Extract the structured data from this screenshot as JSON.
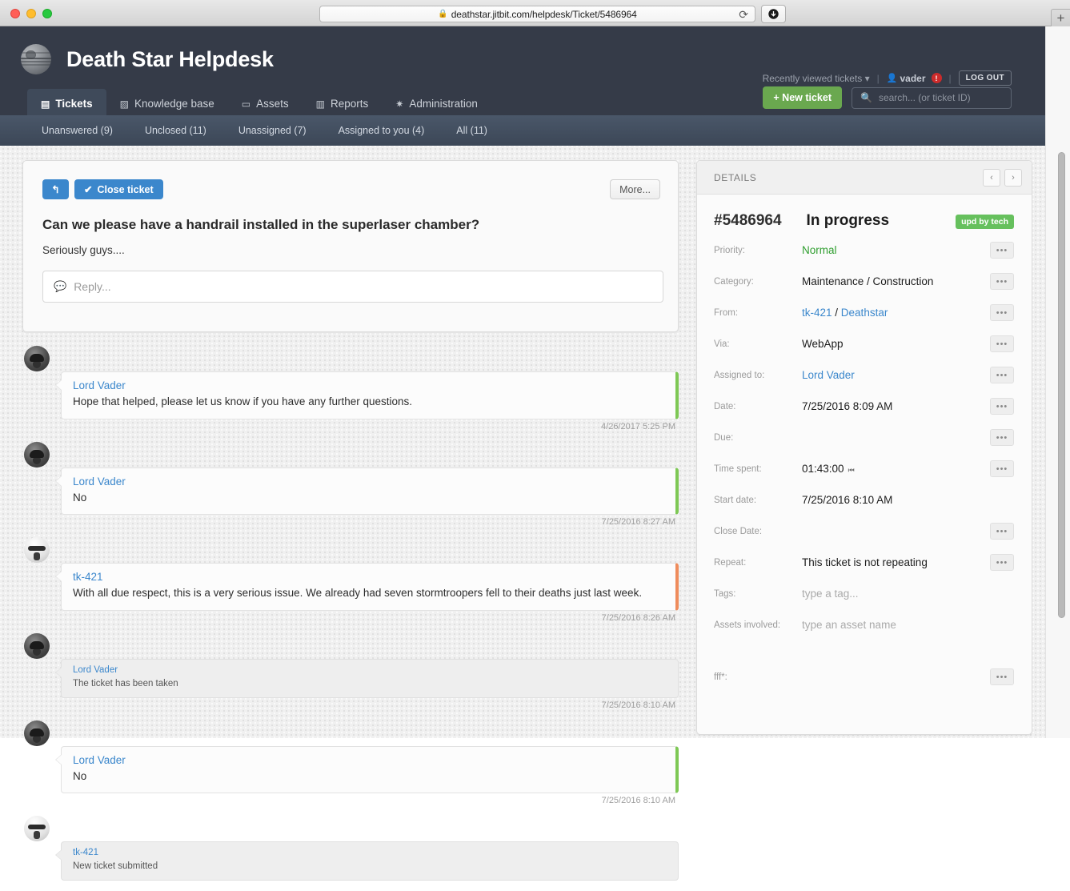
{
  "browser": {
    "url": "deathstar.jitbit.com/helpdesk/Ticket/5486964",
    "lock_icon": "lock-icon",
    "reload_icon": "reload-icon",
    "download_icon": "download-icon",
    "new_tab_label": "+"
  },
  "header": {
    "site_title": "Death Star Helpdesk",
    "logo_icon": "death-star-logo-icon",
    "recently_viewed": "Recently viewed tickets",
    "caret": "▾",
    "user_icon": "user-icon",
    "username": "vader",
    "alert_count": "!",
    "logout_label": "LOG OUT",
    "separator": "|"
  },
  "nav": {
    "tabs": [
      {
        "label": "Tickets",
        "icon": "ticket-icon",
        "glyph": "▤",
        "active": true
      },
      {
        "label": "Knowledge base",
        "icon": "book-icon",
        "glyph": "▨",
        "active": false
      },
      {
        "label": "Assets",
        "icon": "monitor-icon",
        "glyph": "▭",
        "active": false
      },
      {
        "label": "Reports",
        "icon": "chart-icon",
        "glyph": "▥",
        "active": false
      },
      {
        "label": "Administration",
        "icon": "gear-icon",
        "glyph": "✷",
        "active": false
      }
    ],
    "new_ticket_label": "+ New ticket",
    "search_placeholder": "search... (or ticket ID)",
    "search_value": "",
    "search_icon": "search-icon"
  },
  "subnav": {
    "items": [
      {
        "label": "Unanswered (9)"
      },
      {
        "label": "Unclosed (11)"
      },
      {
        "label": "Unassigned (7)"
      },
      {
        "label": "Assigned to you (4)"
      },
      {
        "label": "All (11)"
      }
    ]
  },
  "ticket": {
    "reply_arrow_icon": "reply-arrow-icon",
    "reply_arrow_glyph": "↰",
    "close_ticket_label": "Close ticket",
    "check_glyph": "✔",
    "more_label": "More...",
    "subject": "Can we please have a handrail installed in the superlaser chamber?",
    "body": "Seriously guys....",
    "reply_placeholder": "Reply...",
    "reply_icon": "comment-bubble-icon"
  },
  "comments": [
    {
      "author": "Lord Vader",
      "avatar": "vader-avatar",
      "text": "Hope that helped, please let us know if you have any further questions.",
      "time": "4/26/2017 5:25 PM",
      "accent": "green",
      "system": false
    },
    {
      "author": "Lord Vader",
      "avatar": "vader-avatar",
      "text": "No",
      "time": "7/25/2016 8:27 AM",
      "accent": "green",
      "system": false
    },
    {
      "author": "tk-421",
      "avatar": "trooper-avatar",
      "text": "With all due respect, this is a very serious issue. We already had seven stormtroopers fell to their deaths just last week.",
      "time": "7/25/2016 8:26 AM",
      "accent": "orange",
      "system": false
    },
    {
      "author": "Lord Vader",
      "avatar": "vader-avatar",
      "text": "The ticket has been taken",
      "time": "7/25/2016 8:10 AM",
      "accent": "none",
      "system": true
    },
    {
      "author": "Lord Vader",
      "avatar": "vader-avatar",
      "text": "No",
      "time": "7/25/2016 8:10 AM",
      "accent": "green",
      "system": false
    },
    {
      "author": "tk-421",
      "avatar": "trooper-avatar",
      "text": "New ticket submitted",
      "time": "",
      "accent": "none",
      "system": true
    }
  ],
  "details": {
    "panel_title": "DETAILS",
    "prev_label": "‹",
    "next_label": "›",
    "ticket_number": "#5486964",
    "status": "In progress",
    "badge": "upd by tech",
    "badge_color": "#66c05d",
    "dots_label": "•••",
    "fields": [
      {
        "label": "Priority:",
        "value": "Normal",
        "style": "green",
        "dots": true
      },
      {
        "label": "Category:",
        "value": "Maintenance / Construction",
        "style": "plain",
        "dots": true
      },
      {
        "label": "From:",
        "value": "tk-421 / Deathstar",
        "style": "link-pair",
        "value_a": "tk-421",
        "sep": " / ",
        "value_b": "Deathstar",
        "dots": true
      },
      {
        "label": "Via:",
        "value": "WebApp",
        "style": "plain",
        "dots": true
      },
      {
        "label": "Assigned to:",
        "value": "Lord Vader",
        "style": "link",
        "dots": true
      },
      {
        "label": "Date:",
        "value": "7/25/2016 8:09 AM",
        "style": "plain",
        "dots": true
      },
      {
        "label": "Due:",
        "value": "",
        "style": "plain",
        "dots": true
      },
      {
        "label": "Time spent:",
        "value": "01:43:00",
        "style": "timer",
        "dots": true
      },
      {
        "label": "Start date:",
        "value": "7/25/2016 8:10 AM",
        "style": "plain",
        "dots": false
      },
      {
        "label": "Close Date:",
        "value": "",
        "style": "plain",
        "dots": true
      },
      {
        "label": "Repeat:",
        "value": "This ticket is not repeating",
        "style": "plain",
        "dots": true
      },
      {
        "label": "Tags:",
        "value": "type a tag...",
        "style": "muted",
        "dots": false
      },
      {
        "label": "Assets involved:",
        "value": "type an asset name",
        "style": "muted",
        "dots": false
      },
      {
        "label": "",
        "value": "",
        "style": "plain",
        "dots": false
      },
      {
        "label": "fff*:",
        "value": "",
        "style": "plain",
        "dots": true
      }
    ]
  }
}
